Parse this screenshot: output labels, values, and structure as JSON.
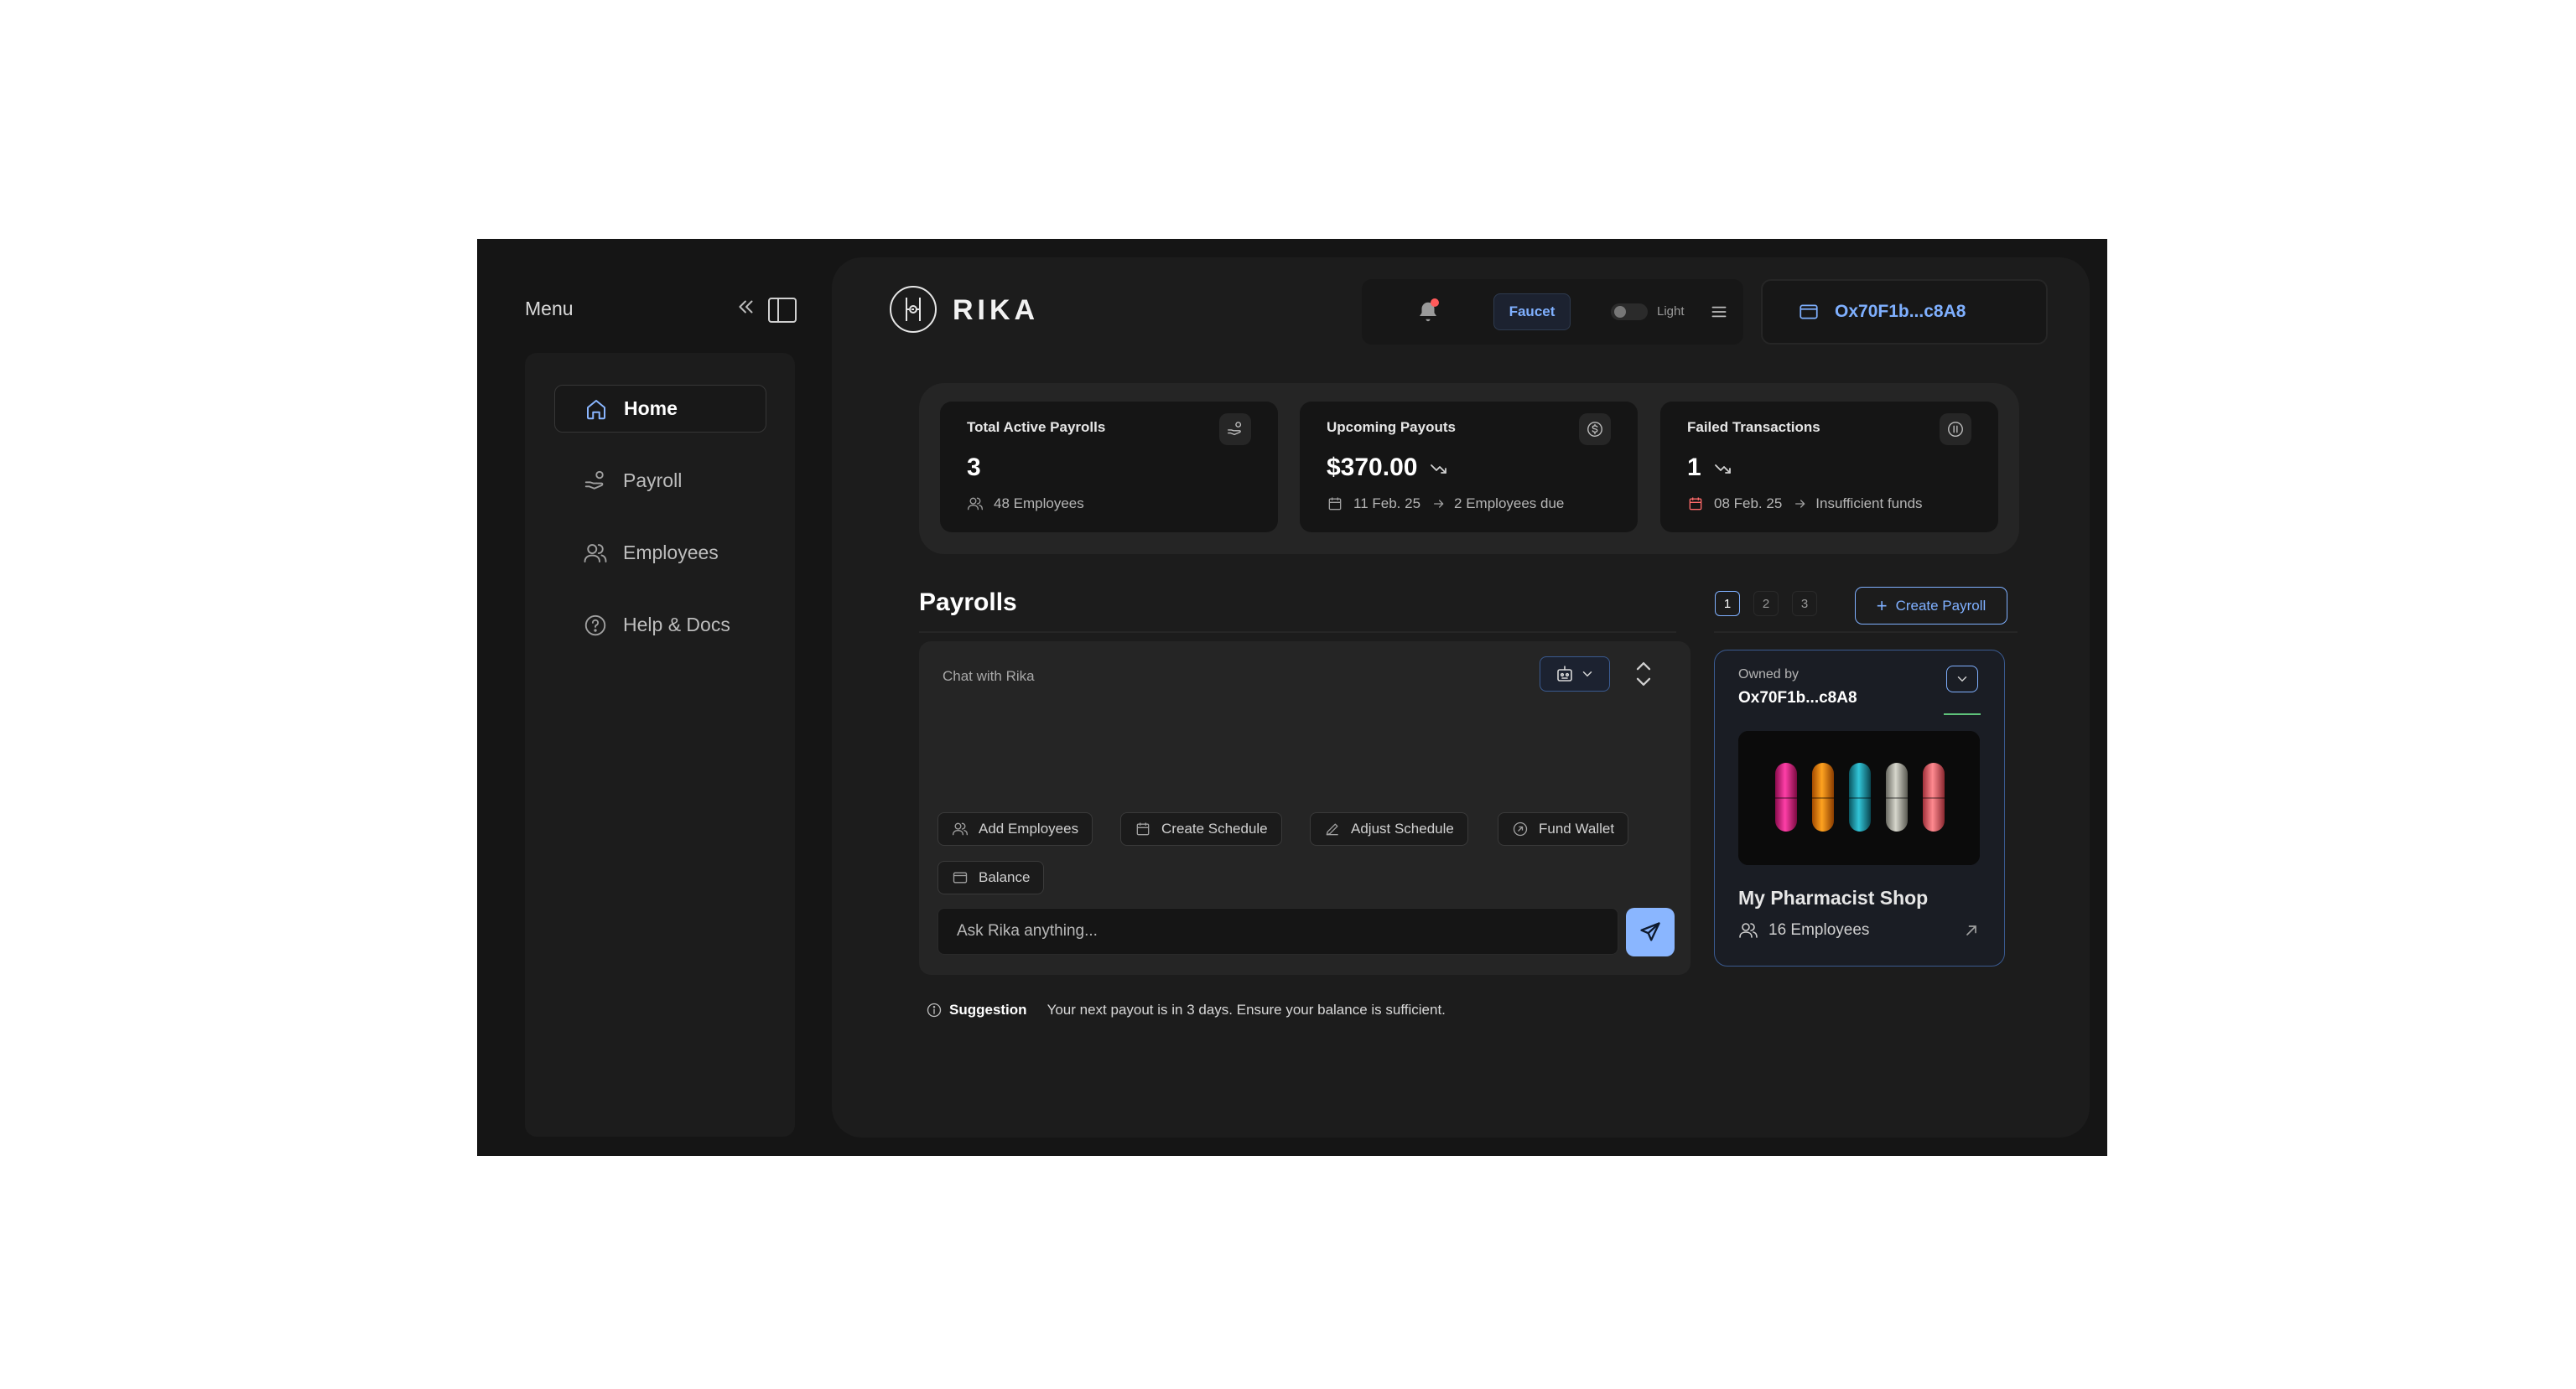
{
  "sidebar": {
    "title": "Menu",
    "items": [
      {
        "label": "Home",
        "icon": "home-icon",
        "active": true
      },
      {
        "label": "Payroll",
        "icon": "hand-coins-icon"
      },
      {
        "label": "Employees",
        "icon": "users-icon"
      },
      {
        "label": "Help & Docs",
        "icon": "help-circle-icon"
      }
    ]
  },
  "header": {
    "brand": "RIKA",
    "faucet_label": "Faucet",
    "theme_label": "Light",
    "wallet_address": "Ox70F1b...c8A8"
  },
  "stats": [
    {
      "title": "Total Active Payrolls",
      "value": "3",
      "meta": "48 Employees"
    },
    {
      "title": "Upcoming Payouts",
      "value": "$370.00",
      "date": "11 Feb. 25",
      "detail": "2 Employees due"
    },
    {
      "title": "Failed Transactions",
      "value": "1",
      "date": "08 Feb. 25",
      "detail": "Insufficient funds"
    }
  ],
  "payrolls": {
    "title": "Payrolls",
    "pages": [
      "1",
      "2",
      "3"
    ],
    "current_page": "1",
    "create_label": "Create Payroll"
  },
  "chat": {
    "title": "Chat with Rika",
    "actions": [
      "Add Employees",
      "Create Schedule",
      "Adjust Schedule",
      "Fund Wallet",
      "Balance"
    ],
    "placeholder": "Ask Rika anything..."
  },
  "suggestion": {
    "label": "Suggestion",
    "text": "Your next payout is in 3 days. Ensure your balance is sufficient."
  },
  "org_card": {
    "owned_label": "Owned by",
    "owner": "Ox70F1b...c8A8",
    "name": "My Pharmacist Shop",
    "employees": "16 Employees"
  },
  "colors": {
    "accent": "#7fb0ff",
    "background": "#151515",
    "panel": "#1c1c1c",
    "notification": "#ff5a5a",
    "status_line": "#5ec27a"
  }
}
